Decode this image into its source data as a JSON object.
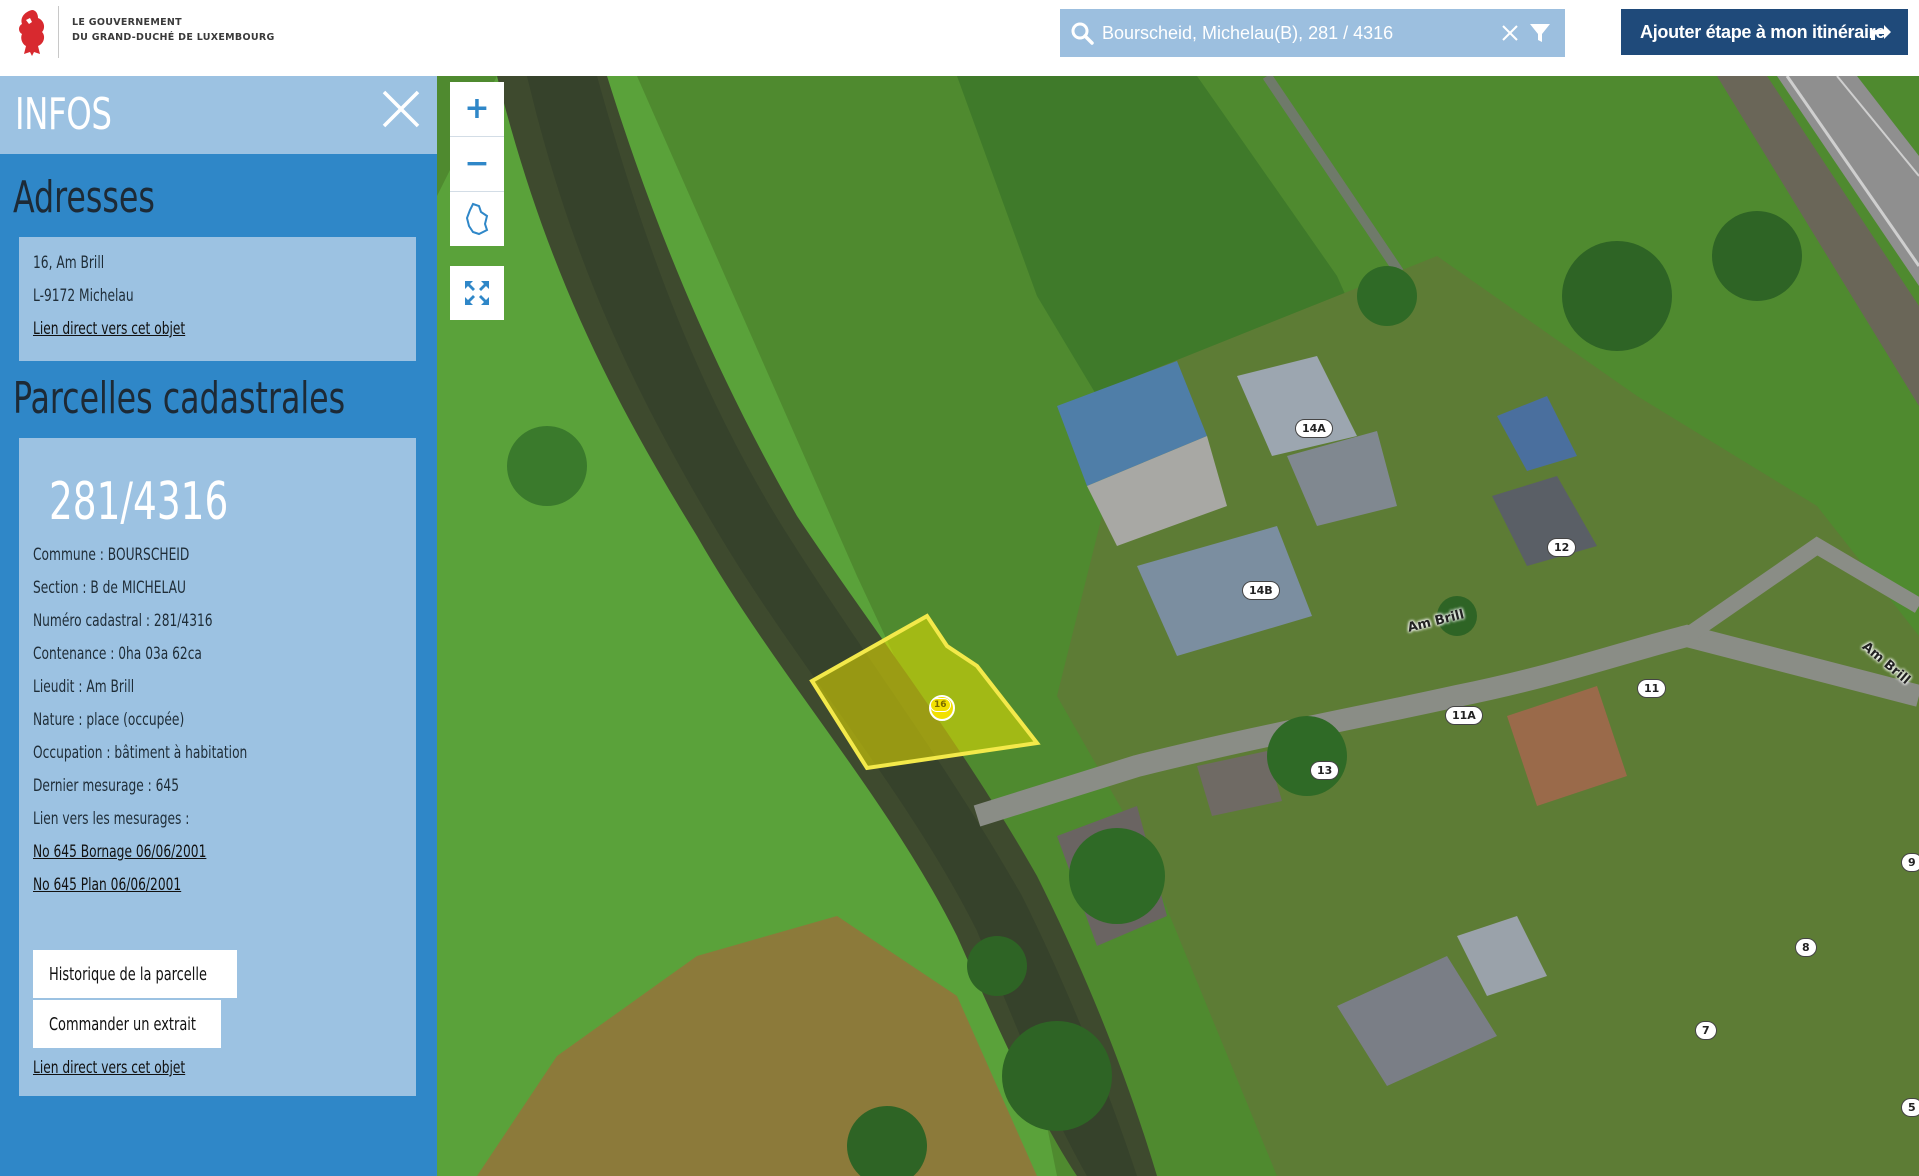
{
  "header": {
    "logo_line1": "LE GOUVERNEMENT",
    "logo_line2": "DU GRAND-DUCHÉ DE LUXEMBOURG",
    "search": {
      "value": "Bourscheid, Michelau(B), 281 / 4316",
      "icon": "search-icon"
    },
    "add_step_label": "Ajouter étape à mon itinéraire"
  },
  "sidebar": {
    "title": "INFOS",
    "addresses_heading": "Adresses",
    "address": {
      "street": "16, Am Brill",
      "city": "L-9172 Michelau",
      "link": "Lien direct vers cet objet"
    },
    "parcels_heading": "Parcelles cadastrales",
    "parcel": {
      "number": "281/4316",
      "fields": [
        "Commune : BOURSCHEID",
        "Section : B de MICHELAU",
        "Numéro cadastral : 281/4316",
        "Contenance : 0ha 03a 62ca",
        "Lieudit : Am Brill",
        "Nature : place (occupée)",
        "Occupation : bâtiment à habitation",
        "Dernier mesurage : 645",
        "Lien vers les mesurages :"
      ],
      "measure_links": [
        "No 645 Bornage 06/06/2001",
        "No 645 Plan 06/06/2001"
      ],
      "history_button": "Historique de la parcelle",
      "order_button": "Commander un extrait",
      "link": "Lien direct vers cet objet"
    }
  },
  "map": {
    "controls": {
      "zoom_in": "+",
      "zoom_out": "−"
    },
    "street_labels": [
      "Am Brill",
      "Am Brill"
    ],
    "house_numbers": [
      "14A",
      "14B",
      "12",
      "16",
      "11",
      "11A",
      "13",
      "8",
      "7",
      "9",
      "5"
    ],
    "colors": {
      "parcel_highlight": "#e8e000",
      "sidebar_blue": "#2f87c8",
      "card_blue": "#9cc2e2",
      "button_navy": "#1f4a7a"
    }
  }
}
